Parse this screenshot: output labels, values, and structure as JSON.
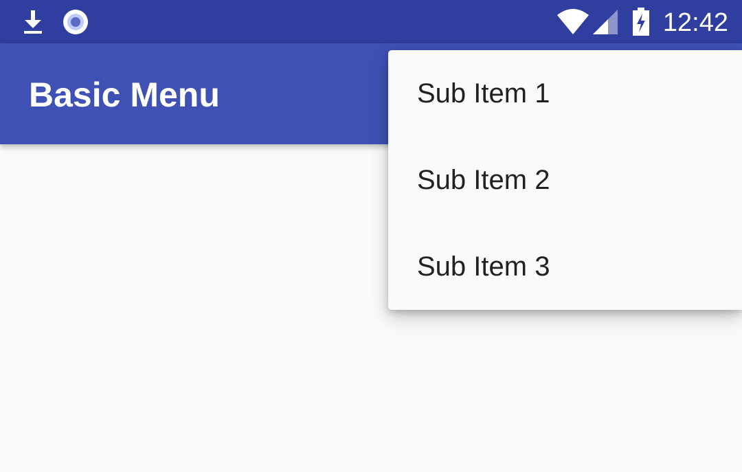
{
  "status_bar": {
    "time": "12:42",
    "left_icons": [
      "download-icon",
      "sync-icon"
    ],
    "right_icons": [
      "wifi-icon",
      "signal-icon",
      "battery-charging-icon"
    ],
    "background": "#303f9f"
  },
  "app_bar": {
    "title": "Basic Menu",
    "background": "#3f51b5"
  },
  "popup_menu": {
    "items": [
      {
        "label": "Sub Item 1"
      },
      {
        "label": "Sub Item 2"
      },
      {
        "label": "Sub Item 3"
      }
    ]
  },
  "colors": {
    "primary": "#3f51b5",
    "primary_dark": "#303f9f",
    "background": "#fafafa",
    "menu_text": "#212121"
  }
}
